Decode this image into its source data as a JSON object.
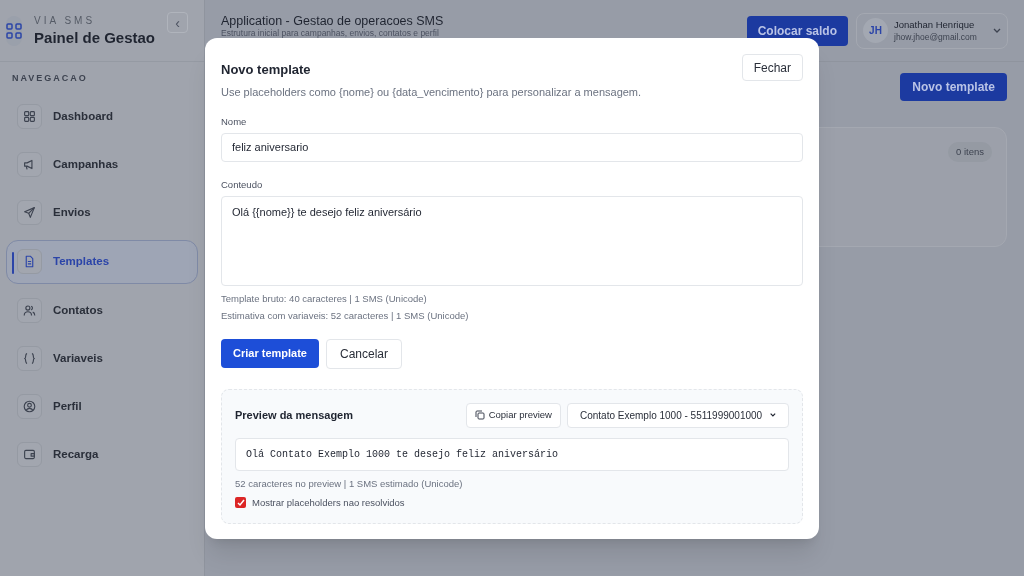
{
  "brand": {
    "eyebrow": "VIA SMS",
    "title": "Painel de Gestao",
    "collapse_icon": "‹"
  },
  "sidebar": {
    "heading": "NAVEGACAO",
    "items": [
      {
        "label": "Dashboard",
        "selected": false
      },
      {
        "label": "Campanhas",
        "selected": false
      },
      {
        "label": "Envios",
        "selected": false
      },
      {
        "label": "Templates",
        "selected": true
      },
      {
        "label": "Contatos",
        "selected": false
      },
      {
        "label": "Variaveis",
        "selected": false
      },
      {
        "label": "Perfil",
        "selected": false
      },
      {
        "label": "Recarga",
        "selected": false
      }
    ]
  },
  "header": {
    "title": "Application - Gestao de operacoes SMS",
    "subtitle": "Estrutura inicial para campanhas, envios, contatos e perfil",
    "balance_button": "Colocar saldo",
    "user": {
      "initials": "JH",
      "name": "Jonathan Henrique",
      "email": "jhow.jhoe@gmail.com"
    }
  },
  "page": {
    "new_button": "Novo template",
    "count_badge": "0 itens"
  },
  "modal": {
    "title": "Novo template",
    "close_button": "Fechar",
    "description": "Use placeholders como {nome} ou {data_vencimento} para personalizar a mensagem.",
    "name_label": "Nome",
    "name_value": "feliz aniversario",
    "content_label": "Conteudo",
    "content_value": "Olá {{nome}} te desejo feliz aniversário",
    "stats": [
      "Template bruto: 40 caracteres | 1 SMS (Unicode)",
      "Estimativa com variaveis: 52 caracteres | 1 SMS (Unicode)"
    ],
    "create_button": "Criar template",
    "cancel_button": "Cancelar",
    "preview": {
      "title": "Preview da mensagem",
      "copy_button": "Copiar preview",
      "contact_select": "Contato Exemplo 1000 - 5511999001000",
      "message": "Olá Contato Exemplo 1000 te desejo feliz aniversário",
      "stats": "52 caracteres no preview | 1 SMS estimado (Unicode)",
      "show_unresolved": {
        "label": "Mostrar placeholders nao resolvidos",
        "checked": true
      }
    }
  }
}
